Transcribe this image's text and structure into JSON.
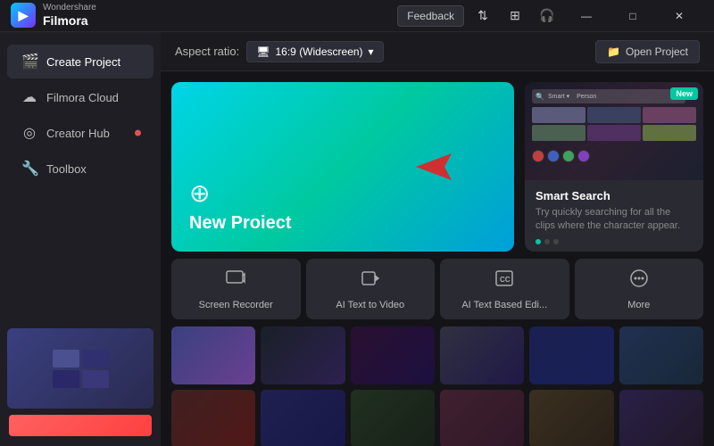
{
  "titlebar": {
    "brand_top": "Wondershare",
    "brand_bottom": "Filmora",
    "feedback_label": "Feedback",
    "min_label": "—",
    "max_label": "□",
    "close_label": "✕"
  },
  "sidebar": {
    "items": [
      {
        "id": "create-project",
        "label": "Create Project",
        "icon": "🎬",
        "active": true,
        "badge": false
      },
      {
        "id": "filmora-cloud",
        "label": "Filmora Cloud",
        "icon": "☁",
        "active": false,
        "badge": false
      },
      {
        "id": "creator-hub",
        "label": "Creator Hub",
        "icon": "◎",
        "active": false,
        "badge": true
      },
      {
        "id": "toolbox",
        "label": "Toolbox",
        "icon": "🧰",
        "active": false,
        "badge": false
      }
    ]
  },
  "topbar": {
    "aspect_ratio_label": "Aspect ratio:",
    "aspect_value": "16:9 (Widescreen)",
    "aspect_icon": "⬜",
    "open_project_label": "Open Project",
    "open_project_icon": "📁"
  },
  "new_project": {
    "plus_icon": "⊕",
    "label": "New Proiect"
  },
  "smart_search": {
    "badge": "New",
    "title": "Smart Search",
    "description": "Try quickly searching for all the clips where the character appear."
  },
  "quick_tools": [
    {
      "id": "screen-recorder",
      "label": "Screen Recorder",
      "icon": "⊡"
    },
    {
      "id": "ai-text-to-video",
      "label": "AI Text to Video",
      "icon": "⊞"
    },
    {
      "id": "ai-text-based-edit",
      "label": "AI Text Based Edi...",
      "icon": "CC"
    },
    {
      "id": "more",
      "label": "More",
      "icon": "⊕"
    }
  ],
  "recent_thumbs": [
    {
      "color": "linear-gradient(135deg,#3a4080,#2a2a50)"
    },
    {
      "color": "linear-gradient(135deg,#1a1a28,#2d2030)"
    },
    {
      "color": "linear-gradient(135deg,#2a2030,#1c2040)"
    },
    {
      "color": "linear-gradient(135deg,#302030,#201828)"
    },
    {
      "color": "linear-gradient(135deg,#1a2030,#282840)"
    },
    {
      "color": "linear-gradient(135deg,#203030,#182828)"
    },
    {
      "color": "linear-gradient(135deg,#302020,#201818)"
    },
    {
      "color": "linear-gradient(135deg,#202030,#181828)"
    },
    {
      "color": "linear-gradient(135deg,#203020,#182018)"
    },
    {
      "color": "linear-gradient(135deg,#302030,#201828)"
    },
    {
      "color": "linear-gradient(135deg,#3a3020,#282018)"
    },
    {
      "color": "linear-gradient(135deg,#2a2038,#201828)"
    }
  ]
}
